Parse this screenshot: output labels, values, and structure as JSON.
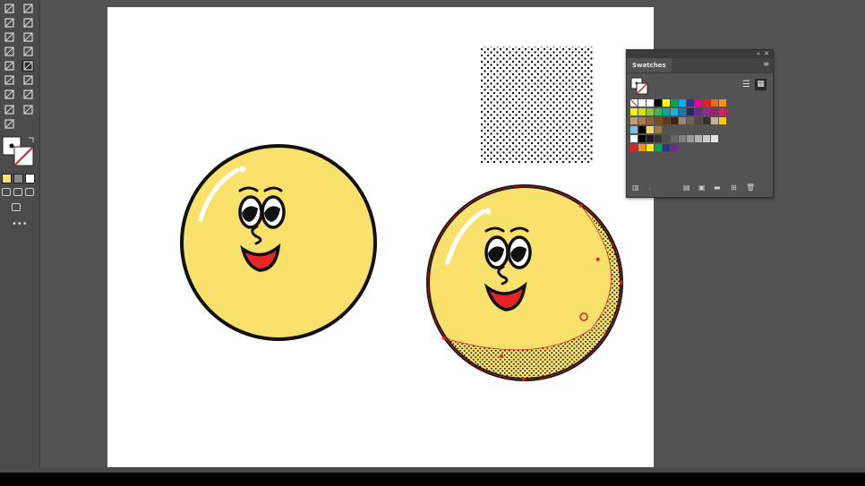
{
  "panel": {
    "title": "Swatches",
    "collapse_icon": "double-chevron-icon",
    "close_icon": "close-icon",
    "menu_icon": "hamburger-menu-icon",
    "view_list_icon": "list-view-icon",
    "view_grid_icon": "grid-view-icon",
    "swatch_rows": [
      [
        "none",
        "#ffffff",
        "#ffffff",
        "#000000",
        "#ffff00",
        "#00a651",
        "#00aeef",
        "#2e3192",
        "#ec008c",
        "#ed1c24",
        "#f26522",
        "#f7941d"
      ],
      [
        "#fff200",
        "#d7df23",
        "#8dc63f",
        "#39b54a",
        "#00a99d",
        "#27aae1",
        "#1b75bc",
        "#262262",
        "#662d91",
        "#92278f",
        "#9e1f63",
        "#da1c5c"
      ],
      [
        "#c69c6d",
        "#a67c52",
        "#8c6239",
        "#754c24",
        "#603913",
        "#42210b",
        "#998675",
        "#736357",
        "#534741",
        "#362f2d",
        "#c7b299",
        "#ffcc00"
      ],
      [
        "#7cc0e6",
        "#000000",
        "#f5d86e",
        "#9c7a4a"
      ],
      [
        "#ffffff",
        "#000000",
        "#1a1a1a",
        "#333333",
        "#4d4d4d",
        "#666666",
        "#808080",
        "#999999",
        "#b3b3b3",
        "#cccccc",
        "#e6e6e6"
      ],
      [
        "#ed1c24",
        "#f7941d",
        "#fff200",
        "#00a651",
        "#2e3192",
        "#662d91"
      ]
    ]
  },
  "canvas": {
    "face_fill": "#f9e16b",
    "outline": "#111111",
    "mouth_fill": "#e5252a",
    "selection_color": "#e02020"
  }
}
